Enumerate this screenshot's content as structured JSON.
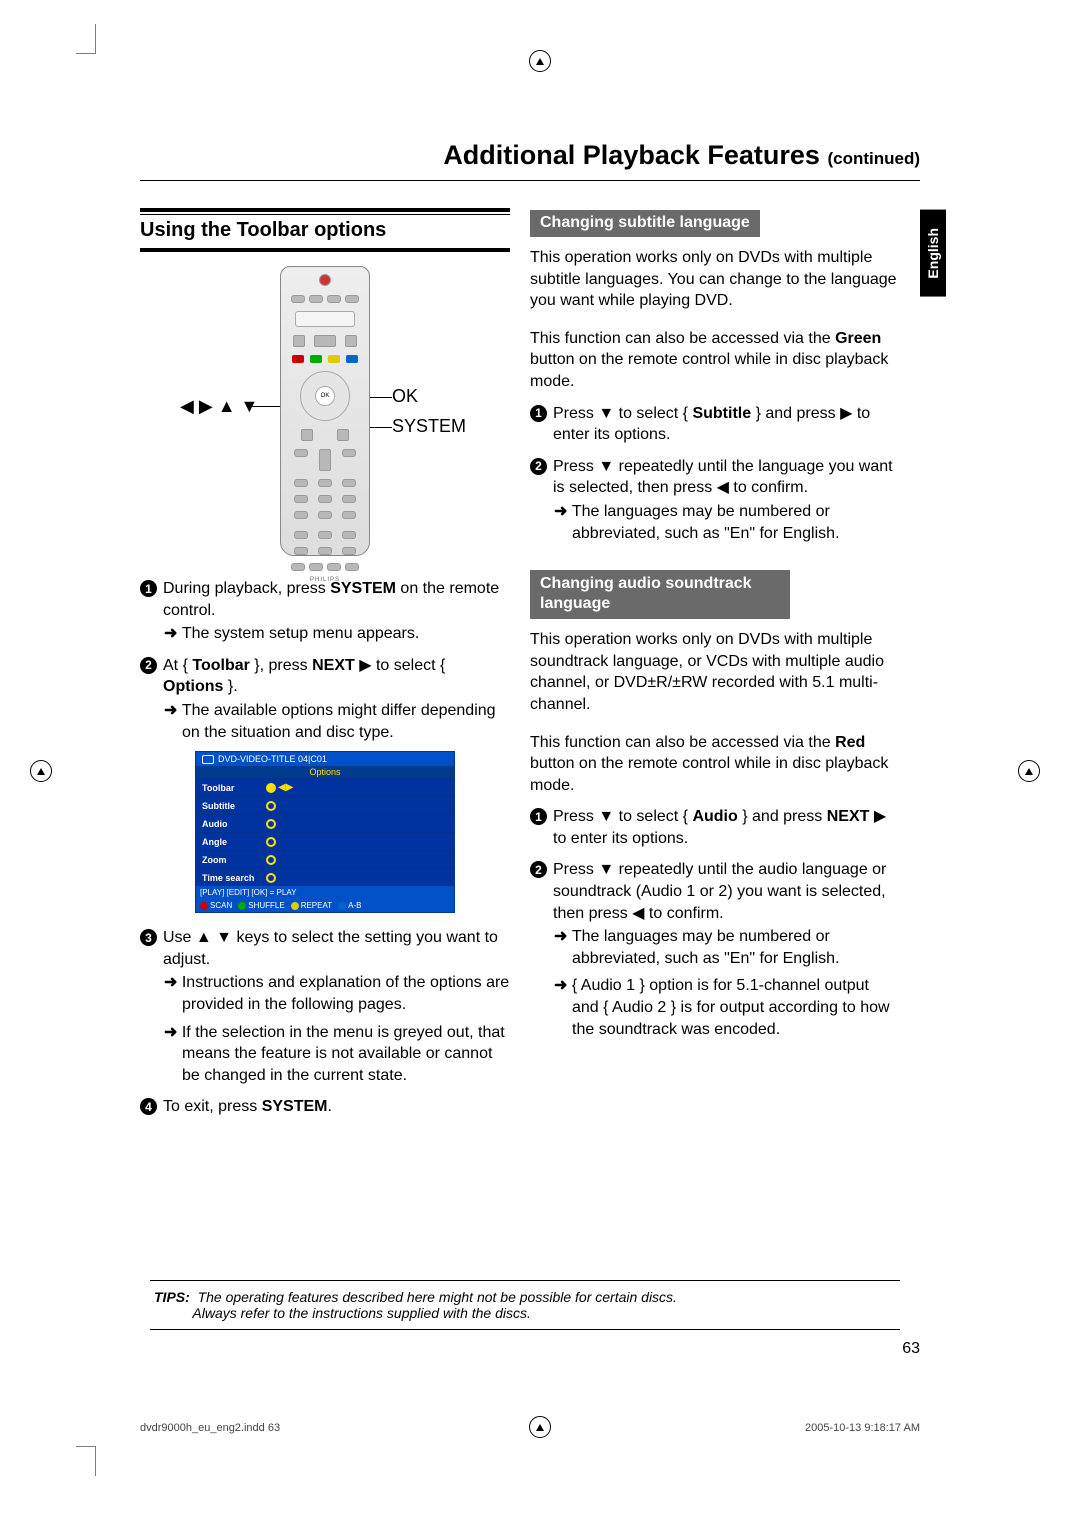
{
  "page": {
    "title_main": "Additional Playback Features",
    "title_cont": "(continued)",
    "language_tab": "English",
    "page_number": "63",
    "footer_left": "dvdr9000h_eu_eng2.indd   63",
    "footer_right": "2005-10-13   9:18:17 AM"
  },
  "left": {
    "section_title": "Using the Toolbar options",
    "remote_callouts": {
      "nav_arrows": "◀ ▶ ▲ ▼",
      "ok": "OK",
      "system": "SYSTEM"
    },
    "steps": [
      {
        "num": "1",
        "text_parts": [
          "During playback, press ",
          "SYSTEM",
          " on the remote control."
        ],
        "results": [
          "The system setup menu appears."
        ]
      },
      {
        "num": "2",
        "text_parts": [
          "At { ",
          "Toolbar",
          " }, press ",
          "NEXT",
          " ▶  to select { ",
          "Options",
          " }."
        ],
        "results": [
          "The available options might differ depending on the situation and disc type."
        ]
      },
      {
        "num": "3",
        "text_parts": [
          "Use ▲ ▼ keys to select the setting you want to adjust."
        ],
        "results": [
          "Instructions and explanation of the options are provided in the following pages.",
          "If the selection in the menu is greyed out, that means the feature is not available or cannot be changed in the current state."
        ]
      },
      {
        "num": "4",
        "text_parts": [
          "To exit, press ",
          "SYSTEM",
          "."
        ],
        "results": []
      }
    ],
    "osd": {
      "top_title": "DVD-VIDEO-TITLE 04|C01",
      "sub_title": "Options",
      "rows": [
        "Toolbar",
        "Subtitle",
        "Audio",
        "Angle",
        "Zoom",
        "Time search"
      ],
      "play_hint": "[PLAY] [EDIT] [OK] = PLAY",
      "footer": [
        {
          "color": "#c00",
          "label": "SCAN"
        },
        {
          "color": "#0a0",
          "label": "SHUFFLE"
        },
        {
          "color": "#dc0",
          "label": "REPEAT"
        },
        {
          "color": "#06c",
          "label": "A-B"
        }
      ]
    }
  },
  "right": {
    "sub1_title": "Changing subtitle language",
    "sub1_p1": "This operation works only on DVDs with multiple subtitle languages. You can change to the language you want while playing DVD.",
    "sub1_p2_parts": [
      "This function can also be accessed via the ",
      "Green",
      " button on the remote control while in disc playback mode."
    ],
    "sub1_steps": [
      {
        "num": "1",
        "text_parts": [
          "Press ▼ to select { ",
          "Subtitle",
          " } and press ▶ to enter its options."
        ]
      },
      {
        "num": "2",
        "text_parts": [
          "Press ▼ repeatedly until the language you want is selected, then press ◀ to confirm."
        ],
        "results": [
          "The languages may be numbered or abbreviated, such as \"En\" for English."
        ]
      }
    ],
    "sub2_title": "Changing audio soundtrack language",
    "sub2_p1": "This operation works only on DVDs with multiple soundtrack language, or VCDs with multiple audio channel, or DVD±R/±RW recorded with 5.1 multi-channel.",
    "sub2_p2_parts": [
      "This function can also be accessed via the ",
      "Red",
      " button on the remote control while in disc playback mode."
    ],
    "sub2_steps": [
      {
        "num": "1",
        "text_parts": [
          "Press ▼ to select { ",
          "Audio",
          " } and press ",
          "NEXT",
          " ▶ to enter its options."
        ]
      },
      {
        "num": "2",
        "text_parts": [
          "Press ▼ repeatedly until the audio language or soundtrack (Audio 1 or 2) you want is selected, then press ◀ to confirm."
        ],
        "results": [
          "The languages may be numbered or abbreviated, such as \"En\" for English.",
          "{ Audio 1 } option is for 5.1-channel output and { Audio 2 } is for output according to how the soundtrack was encoded."
        ]
      }
    ]
  },
  "tips": {
    "label": "TIPS:",
    "line1": "The operating features described here might not be possible for certain discs.",
    "line2": "Always refer to the instructions supplied with the discs."
  }
}
